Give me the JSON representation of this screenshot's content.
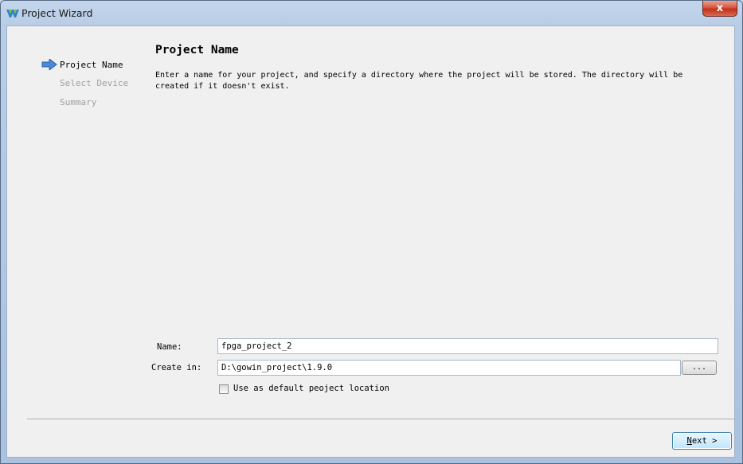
{
  "window": {
    "title": "Project Wizard",
    "close_label": "x",
    "icons": {
      "app": "gowin-logo-icon",
      "close": "close-icon"
    }
  },
  "steps": [
    {
      "label": "Project Name",
      "active": true
    },
    {
      "label": "Select Device",
      "active": false
    },
    {
      "label": "Summary",
      "active": false
    }
  ],
  "page": {
    "title": "Project Name",
    "description": "Enter a name for your project, and specify a directory where the project will be stored. The directory will be\ncreated if it doesn't exist."
  },
  "form": {
    "name_label": "Name:",
    "name_value": "fpga_project_2",
    "create_in_label": "Create in:",
    "create_in_value": "D:\\gowin_project\\1.9.0",
    "browse_label": "...",
    "default_location_label": "Use as default peoject location",
    "default_location_checked": false
  },
  "buttons": {
    "next_mnemonic": "N",
    "next_rest": "ext >"
  },
  "colors": {
    "accent_arrow": "#3a7bd5",
    "inactive_step": "#a0a0a0",
    "close_button": "#c2301c"
  }
}
